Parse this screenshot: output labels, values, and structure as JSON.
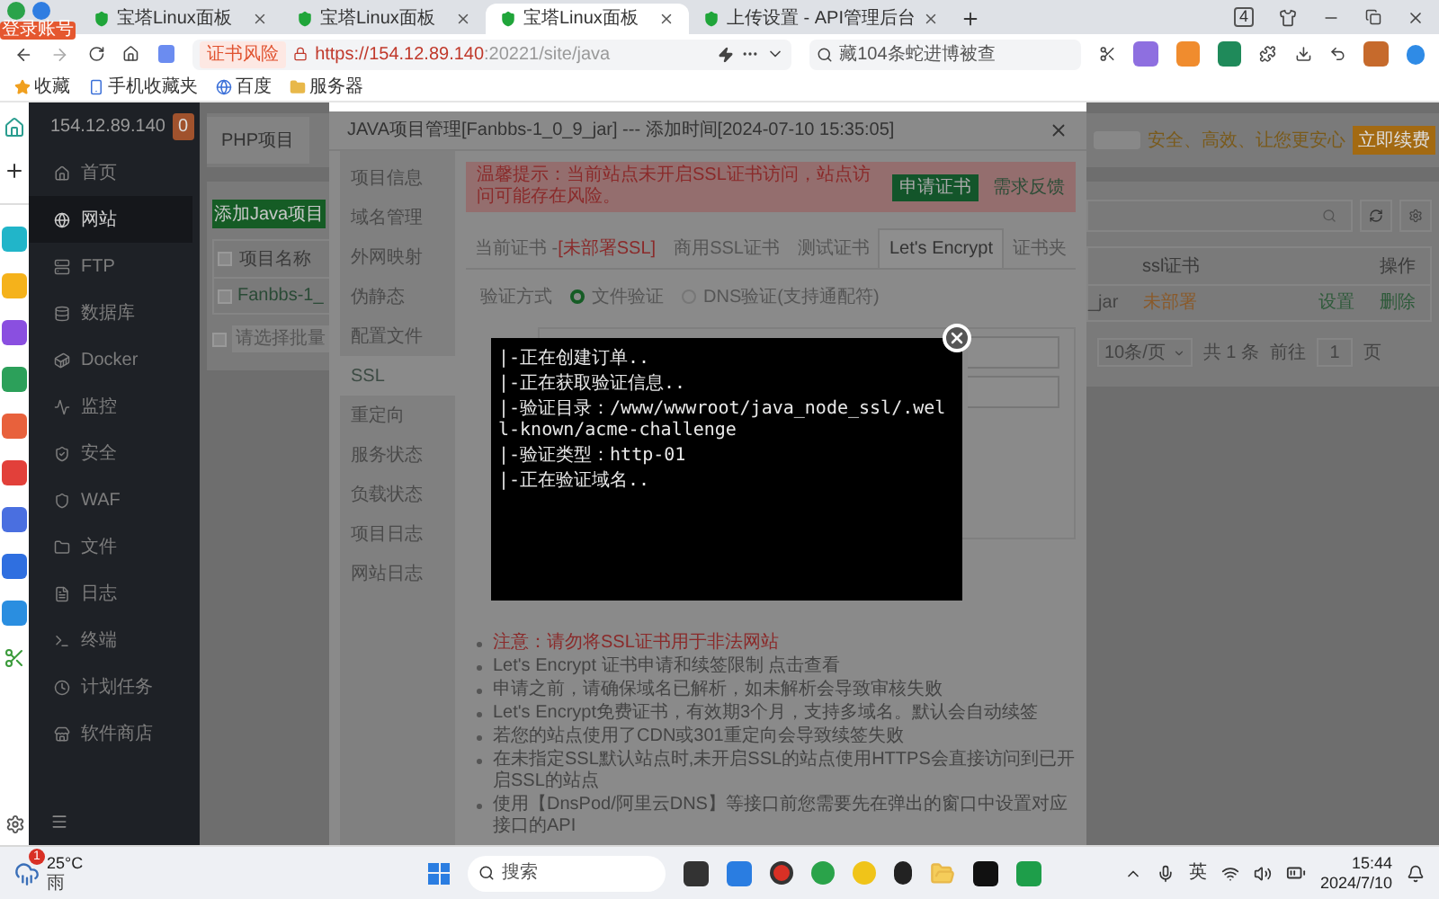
{
  "browser": {
    "tabs": [
      {
        "title": "宝塔Linux面板",
        "selected": false
      },
      {
        "title": "宝塔Linux面板",
        "selected": false
      },
      {
        "title": "宝塔Linux面板",
        "selected": true
      },
      {
        "title": "上传设置 - API管理后台",
        "selected": false
      }
    ],
    "tab_count": "4",
    "profile_badge": "登录账号",
    "cert_warning": "证书风险",
    "url_host": "https://154.12.89.140",
    "url_rest": ":20221/site/java",
    "search": "藏104条蛇进博被查",
    "bookmarks": [
      "收藏",
      "手机收藏夹",
      "百度",
      "服务器"
    ]
  },
  "panel": {
    "host": "154.12.89.140",
    "badge": "0",
    "nav": [
      {
        "label": "首页",
        "selected": false
      },
      {
        "label": "网站",
        "selected": true
      },
      {
        "label": "FTP",
        "selected": false
      },
      {
        "label": "数据库",
        "selected": false
      },
      {
        "label": "Docker",
        "selected": false
      },
      {
        "label": "监控",
        "selected": false
      },
      {
        "label": "安全",
        "selected": false
      },
      {
        "label": "WAF",
        "selected": false
      },
      {
        "label": "文件",
        "selected": false
      },
      {
        "label": "日志",
        "selected": false
      },
      {
        "label": "终端",
        "selected": false
      },
      {
        "label": "计划任务",
        "selected": false
      },
      {
        "label": "软件商店",
        "selected": false
      }
    ]
  },
  "site_list": {
    "tab": "PHP项目",
    "add_button": "添加Java项目",
    "header_checked": false,
    "column_name": "项目名称",
    "row_checked": false,
    "row_name": "Fanbbs-1_",
    "batch_checked": false,
    "batch_select": "请选择批量",
    "promo": "安全、高效、让您更安心",
    "renew_button": "立即续费",
    "column_ssl": "ssl证书",
    "column_actions": "操作",
    "row_name_end": "_jar",
    "row_ssl": "未部署",
    "row_set": "设置",
    "row_delete": "删除",
    "page_size": "10条/页",
    "total": "共 1 条",
    "goto": "前往",
    "page": "1",
    "page_unit": "页"
  },
  "dialog": {
    "title": "JAVA项目管理[Fanbbs-1_0_9_jar] --- 添加时间[2024-07-10 15:35:05]",
    "menu": [
      {
        "label": "项目信息",
        "selected": false
      },
      {
        "label": "域名管理",
        "selected": false
      },
      {
        "label": "外网映射",
        "selected": false
      },
      {
        "label": "伪静态",
        "selected": false
      },
      {
        "label": "配置文件",
        "selected": false
      },
      {
        "label": "SSL",
        "selected": true
      },
      {
        "label": "重定向",
        "selected": false
      },
      {
        "label": "服务状态",
        "selected": false
      },
      {
        "label": "负载状态",
        "selected": false
      },
      {
        "label": "项目日志",
        "selected": false
      },
      {
        "label": "网站日志",
        "selected": false
      }
    ],
    "alert": {
      "text": "温馨提示：当前站点未开启SSL证书访问，站点访问可能存在风险。",
      "button": "申请证书",
      "feedback": "需求反馈"
    },
    "tabs": [
      {
        "label": "当前证书 - ",
        "status": "[未部署SSL]",
        "selected": false
      },
      {
        "label": "商用SSL证书",
        "selected": false
      },
      {
        "label": "测试证书",
        "selected": false
      },
      {
        "label": "Let's Encrypt",
        "selected": true
      },
      {
        "label": "证书夹",
        "selected": false
      }
    ],
    "verify_label": "验证方式",
    "verify_options": [
      {
        "label": "文件验证",
        "selected": true
      },
      {
        "label": "DNS验证(支持通配符)",
        "selected": false
      }
    ],
    "notes": [
      {
        "text": "注意：请勿将SSL证书用于非法网站",
        "kind": "warning"
      },
      {
        "text": "Let's Encrypt 证书申请和续签限制 点击查看",
        "kind": "normal"
      },
      {
        "text": "申请之前，请确保域名已解析，如未解析会导致审核失败",
        "kind": "normal"
      },
      {
        "text": "Let's Encrypt免费证书，有效期3个月，支持多域名。默认会自动续签",
        "kind": "normal"
      },
      {
        "text": "若您的站点使用了CDN或301重定向会导致续签失败",
        "kind": "normal"
      },
      {
        "text": "在未指定SSL默认站点时,未开启SSL的站点使用HTTPS会直接访问到已开启SSL的站点",
        "kind": "normal"
      },
      {
        "text": "使用【DnsPod/阿里云DNS】等接口前您需要先在弹出的窗口中设置对应接口的API",
        "kind": "normal"
      }
    ]
  },
  "terminal": {
    "lines": [
      "|-正在创建订单..",
      "|-正在获取验证信息..",
      "|-验证目录：/www/wwwroot/java_node_ssl/.well-known/acme-challenge",
      "|-验证类型：http-01",
      "|-正在验证域名.."
    ]
  },
  "taskbar": {
    "weather_badge": "1",
    "temperature": "25°C",
    "weather": "雨",
    "search": "搜索",
    "ime": "英",
    "time": "15:44",
    "date": "2024/7/10"
  }
}
